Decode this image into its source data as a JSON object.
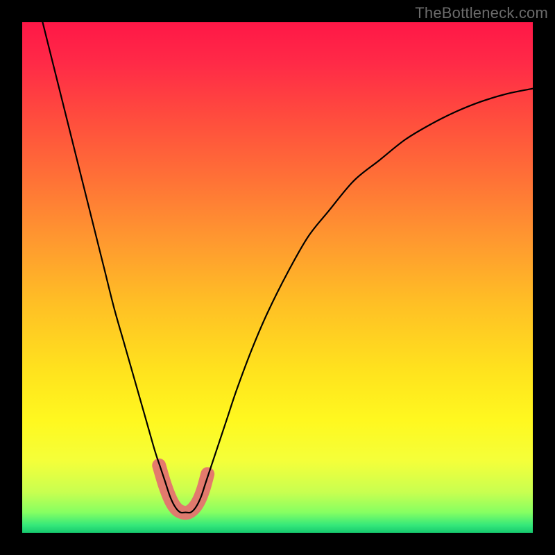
{
  "watermark": "TheBottleneck.com",
  "gradient": {
    "stops": [
      {
        "offset": 0.0,
        "color": "#ff1747"
      },
      {
        "offset": 0.08,
        "color": "#ff2a47"
      },
      {
        "offset": 0.18,
        "color": "#ff4a3e"
      },
      {
        "offset": 0.3,
        "color": "#ff6f37"
      },
      {
        "offset": 0.42,
        "color": "#ff9630"
      },
      {
        "offset": 0.55,
        "color": "#ffbf25"
      },
      {
        "offset": 0.68,
        "color": "#ffe21e"
      },
      {
        "offset": 0.78,
        "color": "#fff81f"
      },
      {
        "offset": 0.86,
        "color": "#f4ff3a"
      },
      {
        "offset": 0.92,
        "color": "#c9ff50"
      },
      {
        "offset": 0.96,
        "color": "#86ff62"
      },
      {
        "offset": 0.985,
        "color": "#35e87a"
      },
      {
        "offset": 1.0,
        "color": "#16c96e"
      }
    ]
  },
  "highlight": {
    "color": "#e4736f",
    "stroke_width": 20,
    "linecap": "round"
  },
  "curve": {
    "color": "#000000",
    "stroke_width": 2.2
  },
  "chart_data": {
    "type": "line",
    "title": "",
    "xlabel": "",
    "ylabel": "",
    "xlim": [
      0,
      100
    ],
    "ylim": [
      0,
      100
    ],
    "grid": false,
    "legend": false,
    "series": [
      {
        "name": "bottleneck-curve",
        "x": [
          4,
          6,
          8,
          10,
          12,
          14,
          16,
          18,
          20,
          22,
          24,
          26,
          27,
          28,
          29,
          30,
          31,
          32,
          33,
          34,
          35,
          36,
          38,
          40,
          42,
          45,
          48,
          52,
          56,
          60,
          65,
          70,
          75,
          80,
          85,
          90,
          95,
          100
        ],
        "y": [
          100,
          92,
          84,
          76,
          68,
          60,
          52,
          44,
          37,
          30,
          23,
          16,
          13,
          10,
          7,
          5,
          4,
          4,
          4,
          5,
          7,
          10,
          16,
          22,
          28,
          36,
          43,
          51,
          58,
          63,
          69,
          73,
          77,
          80,
          82.5,
          84.5,
          86,
          87
        ]
      },
      {
        "name": "highlight-segment",
        "x": [
          26.8,
          28.0,
          29.2,
          30.3,
          31.4,
          32.5,
          33.6,
          34.6,
          35.5,
          36.3
        ],
        "y": [
          13.2,
          9.2,
          6.2,
          4.6,
          4.0,
          4.0,
          4.8,
          6.3,
          8.6,
          11.5
        ]
      }
    ]
  }
}
